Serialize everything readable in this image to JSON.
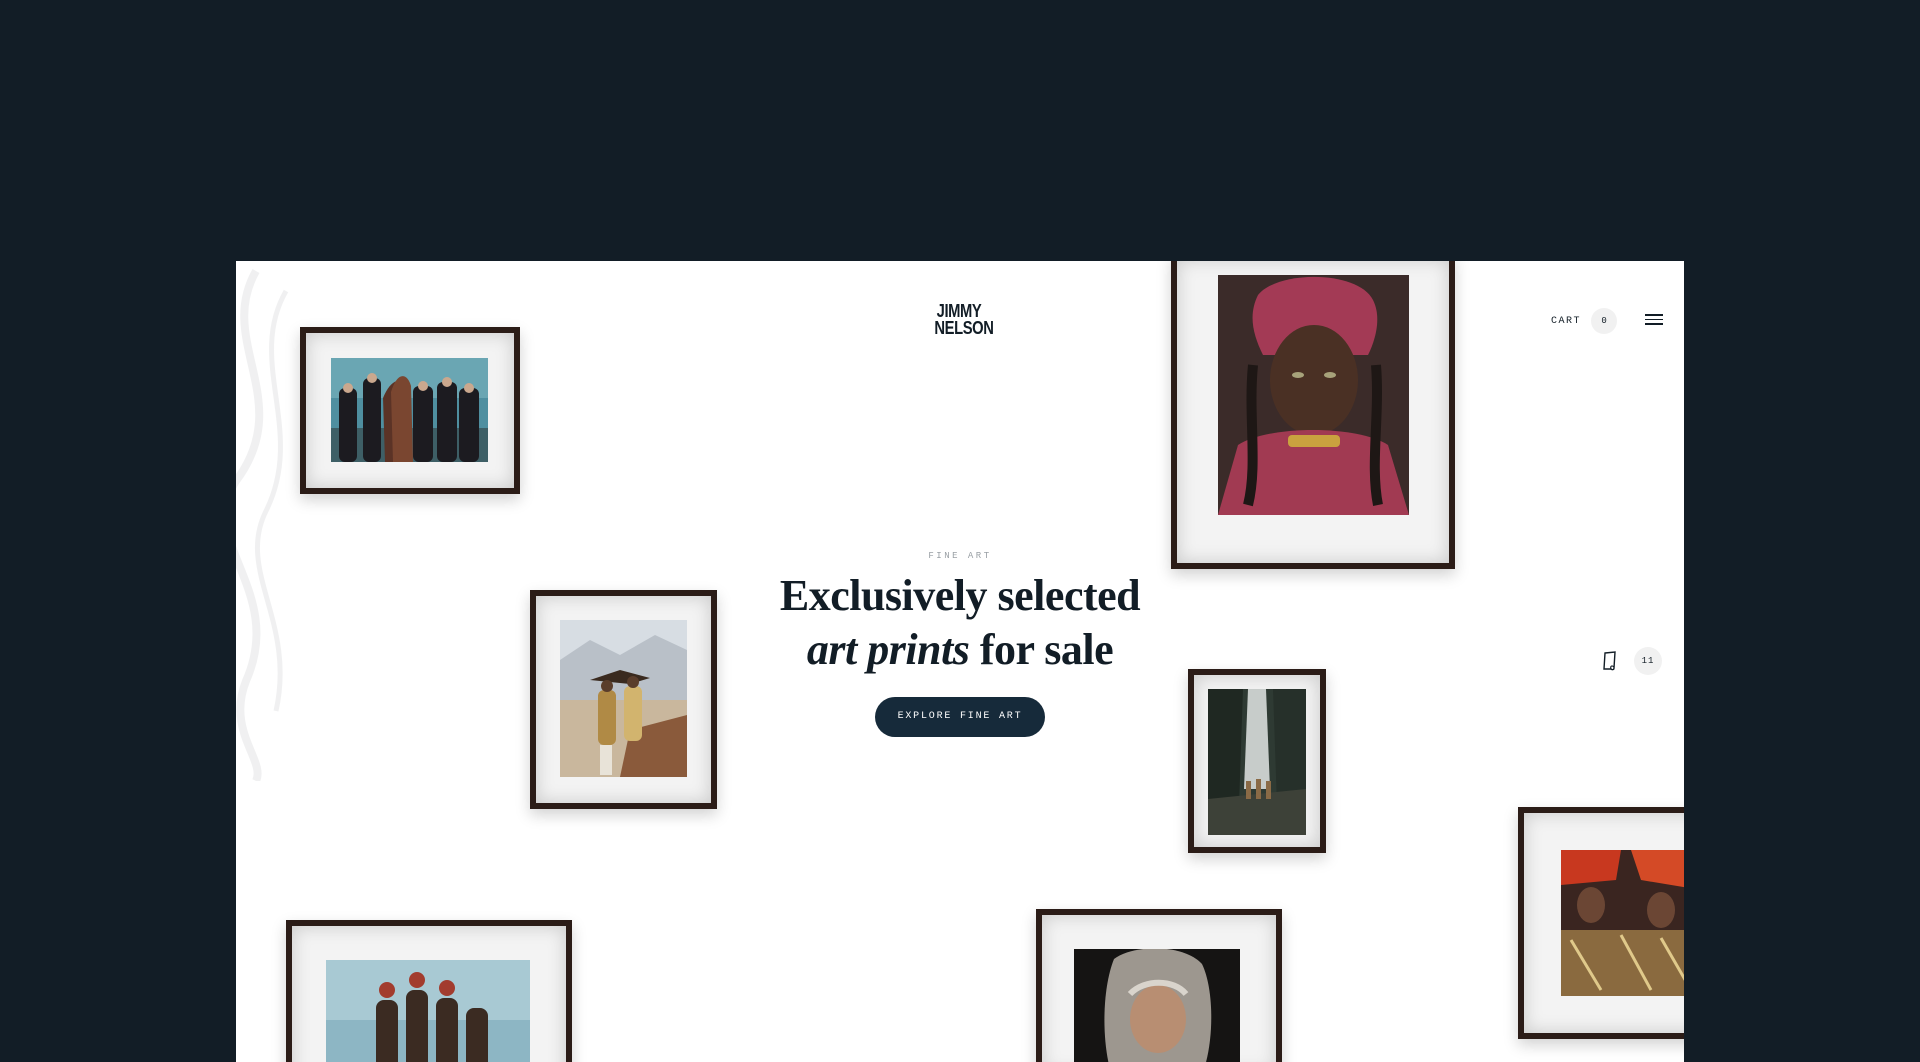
{
  "header": {
    "logo_line1": "JIMMY",
    "logo_line2": "NELSON",
    "cart_label": "CART",
    "cart_count": "0",
    "menu_icon": "hamburger-menu-icon"
  },
  "hero": {
    "eyebrow": "FINE ART",
    "headline_line1": "Exclusively selected",
    "headline_italic": "art prints",
    "headline_rest": " for sale",
    "cta_label": "EXPLORE FINE ART"
  },
  "side_counter": {
    "icon": "print-frame-icon",
    "count": "11"
  },
  "colors": {
    "page_bg": "#121d26",
    "canvas_bg": "#ffffff",
    "frame": "#2b1c17",
    "mat": "#f3f3f3",
    "accent_button": "#162a3a"
  }
}
